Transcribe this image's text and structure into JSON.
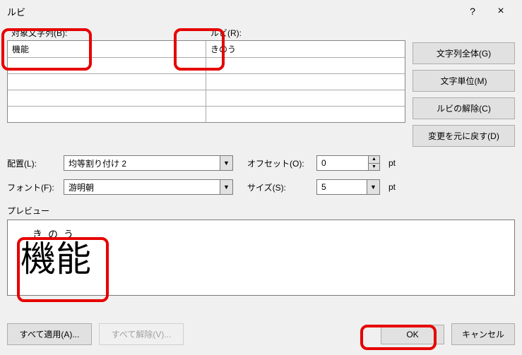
{
  "title": "ルビ",
  "help_symbol": "?",
  "close_symbol": "×",
  "headers": {
    "base": "対象文字列(B):",
    "ruby": "ルビ(R):"
  },
  "rows": [
    {
      "base": "機能",
      "ruby": "きのう"
    },
    {
      "base": "",
      "ruby": ""
    },
    {
      "base": "",
      "ruby": ""
    },
    {
      "base": "",
      "ruby": ""
    },
    {
      "base": "",
      "ruby": ""
    }
  ],
  "side_buttons": {
    "group": "文字列全体(G)",
    "mono": "文字単位(M)",
    "remove": "ルビの解除(C)",
    "reset": "変更を元に戻す(D)"
  },
  "layout": {
    "align_label": "配置(L):",
    "align_value": "均等割り付け 2",
    "offset_label": "オフセット(O):",
    "offset_value": "0",
    "font_label": "フォント(F):",
    "font_value": "游明朝",
    "size_label": "サイズ(S):",
    "size_value": "5",
    "unit": "pt"
  },
  "preview": {
    "label": "プレビュー",
    "ruby_text": "きのう",
    "base_text": "機能"
  },
  "footer": {
    "apply_all": "すべて適用(A)...",
    "remove_all": "すべて解除(V)...",
    "ok": "OK",
    "cancel": "キャンセル"
  }
}
